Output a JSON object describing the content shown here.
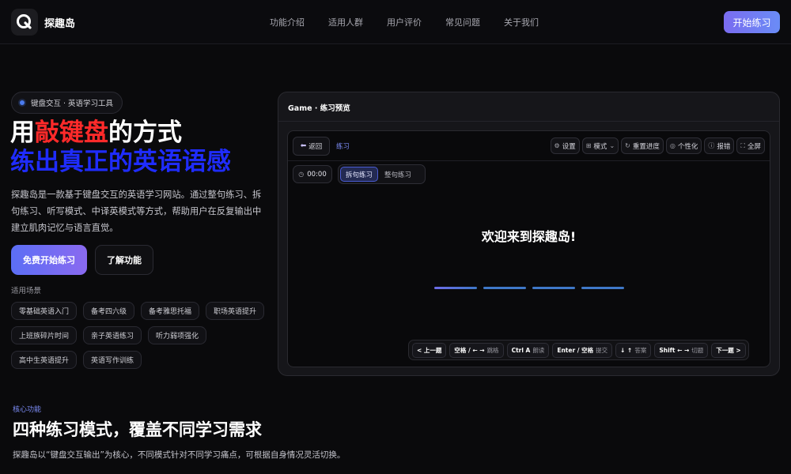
{
  "header": {
    "brand": "探趣岛",
    "nav": [
      "功能介绍",
      "适用人群",
      "用户评价",
      "常见问题",
      "关于我们"
    ],
    "cta": "开始练习"
  },
  "hero": {
    "badge": "键盘交互 · 英语学习工具",
    "title_line1_pre": "用",
    "title_line1_highlight": "敲键盘",
    "title_line1_post": "的方式",
    "title_line2": "练出真正的英语语感",
    "description": "探趣岛是一款基于键盘交互的英语学习网站。通过整句练习、拆句练习、听写模式、中译英模式等方式，帮助用户在反复输出中建立肌肉记忆与语言直觉。",
    "primary_button": "免费开始练习",
    "secondary_button": "了解功能",
    "scenarios_label": "适用场景",
    "scenarios": [
      "零基础英语入门",
      "备考四六级",
      "备考雅思托福",
      "职场英语提升",
      "上班族碎片时间",
      "亲子英语练习",
      "听力弱项强化",
      "高中生英语提升",
      "英语写作训练"
    ]
  },
  "preview": {
    "title": "Game · 练习预览",
    "back_label": "返回",
    "breadcrumb": "练习",
    "tools": [
      {
        "icon": "settings-icon",
        "label": "设置"
      },
      {
        "icon": "grid-icon",
        "label": "模式"
      },
      {
        "icon": "reset-icon",
        "label": "重置进度"
      },
      {
        "icon": "palette-icon",
        "label": "个性化"
      },
      {
        "icon": "info-icon",
        "label": "报错"
      },
      {
        "icon": "fullscreen-icon",
        "label": "全屏"
      }
    ],
    "timer": "00:00",
    "modes": [
      "拆句练习",
      "整句练习"
    ],
    "active_mode": "拆句练习",
    "welcome": "欢迎来到探趣岛!",
    "blank_count": 4,
    "shortcuts": [
      {
        "key": "< 上一题",
        "desc": ""
      },
      {
        "key": "空格 / ← →",
        "desc": "跳格"
      },
      {
        "key": "Ctrl A",
        "desc": "朗读"
      },
      {
        "key": "Enter / 空格",
        "desc": "提交"
      },
      {
        "key": "↓ ↑",
        "desc": "答案"
      },
      {
        "key": "Shift ← →",
        "desc": "切题"
      },
      {
        "key": "下一题 >",
        "desc": ""
      }
    ]
  },
  "features": {
    "tag": "核心功能",
    "title": "四种练习模式，覆盖不同学习需求",
    "description": "探趣岛以“键盘交互输出”为核心，不同模式针对不同学习痛点，可根据自身情况灵活切换。"
  },
  "colors": {
    "accent": "#6a7cf4",
    "highlight_red": "#ff2a2a",
    "highlight_blue": "#1f2cff",
    "background": "#0a0a0c"
  }
}
